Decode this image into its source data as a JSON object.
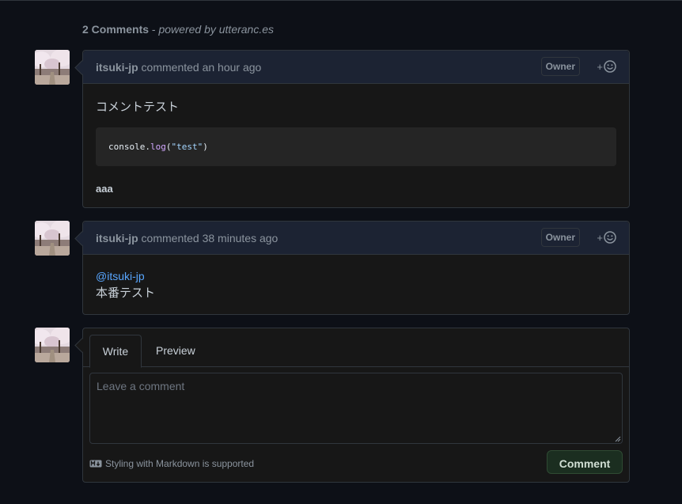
{
  "header": {
    "comment_count": "2 Comments",
    "separator": " - ",
    "powered_by": "powered by utteranc.es"
  },
  "comments": [
    {
      "author": "itsuki-jp",
      "action": " commented an hour ago",
      "badge": "Owner",
      "reaction_plus": "+",
      "text": "コメントテスト",
      "code": {
        "obj": "console",
        "dot": ".",
        "fn": "log",
        "open": "(",
        "str": "\"test\"",
        "close": ")"
      },
      "strong": "aaa"
    },
    {
      "author": "itsuki-jp",
      "action": " commented 38 minutes ago",
      "badge": "Owner",
      "reaction_plus": "+",
      "mention": "@itsuki-jp",
      "text": "本番テスト"
    }
  ],
  "form": {
    "tab_write": "Write",
    "tab_preview": "Preview",
    "placeholder": "Leave a comment",
    "markdown_note": "Styling with Markdown is supported",
    "submit_label": "Comment"
  },
  "icons": {
    "reaction": "smiley-icon",
    "markdown": "markdown-icon",
    "avatar": "cherry-blossom-avatar"
  },
  "colors": {
    "background": "#0d1017",
    "card_header": "#1c2333",
    "card_body": "#171717",
    "link": "#58a6ff",
    "submit_bg": "#1b2e20"
  }
}
